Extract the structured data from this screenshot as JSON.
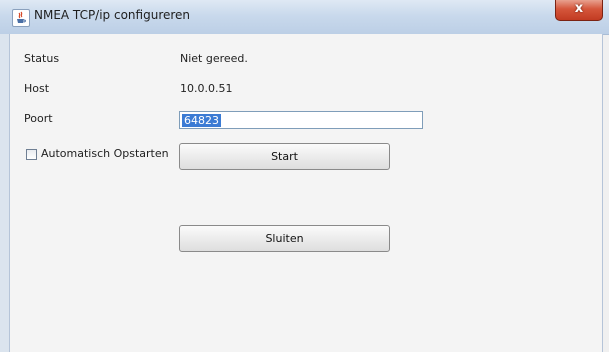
{
  "window": {
    "title": "NMEA TCP/ip configureren",
    "close_glyph": "x"
  },
  "form": {
    "status_label": "Status",
    "status_value": "Niet gereed.",
    "host_label": "Host",
    "host_value": "10.0.0.51",
    "port_label": "Poort",
    "port_value": "64823",
    "autostart_label": "Automatisch Opstarten",
    "autostart_checked": false
  },
  "buttons": {
    "start_label": "Start",
    "close_label": "Sluiten"
  },
  "icons": {
    "app": "java-app-icon",
    "close": "close-icon"
  }
}
